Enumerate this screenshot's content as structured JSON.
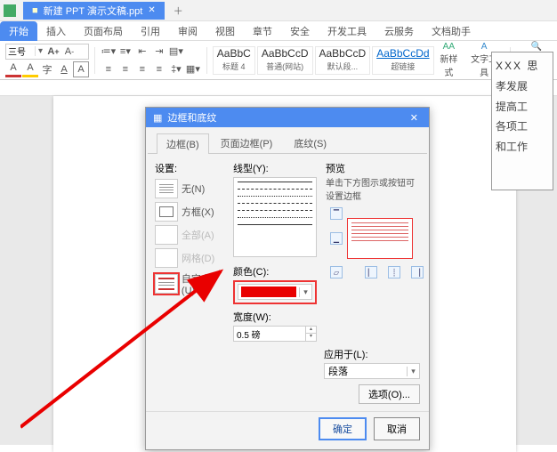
{
  "doc_tab_title": "新建 PPT 演示文稿.ppt",
  "menu_tabs": [
    "开始",
    "插入",
    "页面布局",
    "引用",
    "审阅",
    "视图",
    "章节",
    "安全",
    "开发工具",
    "云服务",
    "文档助手"
  ],
  "menu_active_index": 0,
  "font": {
    "name": "三号",
    "a_up": "A",
    "a_dn": "A"
  },
  "styles": [
    {
      "sample": "AaBbC",
      "label": "标题 4"
    },
    {
      "sample": "AaBbCcD",
      "label": "普通(网站)"
    },
    {
      "sample": "AaBbCcD",
      "label": "默认段..."
    },
    {
      "sample": "AaBbCcDd",
      "label": "超链接",
      "link": true
    }
  ],
  "ribbon_right": [
    "新样式",
    "文字工具",
    "查找替换"
  ],
  "text_box_lines": [
    "XXX 思",
    "孝发展",
    "提高工",
    "各项工",
    "和工作"
  ],
  "dialog": {
    "title": "边框和底纹",
    "tabs": [
      "边框(B)",
      "页面边框(P)",
      "底纹(S)"
    ],
    "active_tab": 0,
    "settings_label": "设置:",
    "settings": [
      {
        "key": "none",
        "label": "无(N)",
        "enabled": true
      },
      {
        "key": "box",
        "label": "方框(X)",
        "enabled": true
      },
      {
        "key": "all",
        "label": "全部(A)",
        "enabled": false
      },
      {
        "key": "grid",
        "label": "网格(D)",
        "enabled": false
      },
      {
        "key": "custom",
        "label": "自定义(U)",
        "enabled": true,
        "selected": true
      }
    ],
    "linetype_label": "线型(Y):",
    "color_label": "颜色(C):",
    "color_value": "#e90000",
    "width_label": "宽度(W):",
    "width_value": "0.5  磅",
    "preview_label": "预览",
    "preview_hint": "单击下方图示或按钮可设置边框",
    "apply_label": "应用于(L):",
    "apply_value": "段落",
    "options_btn": "选项(O)...",
    "ok": "确定",
    "cancel": "取消"
  }
}
